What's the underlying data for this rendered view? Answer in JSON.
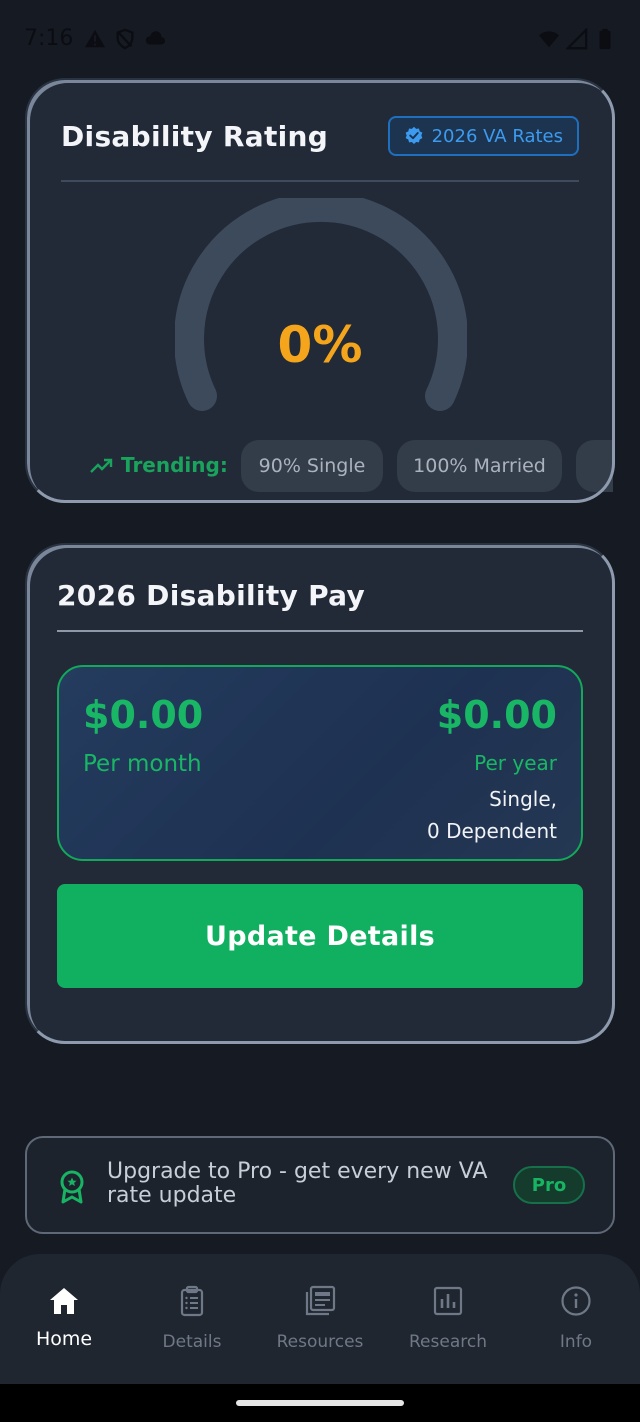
{
  "status_bar": {
    "time": "7:16"
  },
  "rating_card": {
    "title": "Disability Rating",
    "badge": "2026 VA Rates",
    "gauge_value": "0%",
    "gauge_fraction": 0,
    "trending_label": "Trending:",
    "chips": [
      "90% Single",
      "100% Married",
      ""
    ]
  },
  "pay_card": {
    "title": "2026 Disability Pay",
    "monthly_amount": "$0.00",
    "monthly_label": "Per month",
    "yearly_amount": "$0.00",
    "yearly_label": "Per year",
    "status_line1": "Single,",
    "status_line2": "0 Dependent",
    "update_button": "Update Details"
  },
  "pro_banner": {
    "text": "Upgrade to Pro - get every new VA rate update",
    "chip": "Pro"
  },
  "nav": {
    "items": [
      {
        "label": "Home",
        "icon": "home-icon",
        "active": true
      },
      {
        "label": "Details",
        "icon": "clipboard-icon",
        "active": false
      },
      {
        "label": "Resources",
        "icon": "newspaper-icon",
        "active": false
      },
      {
        "label": "Research",
        "icon": "bar-chart-icon",
        "active": false
      },
      {
        "label": "Info",
        "icon": "info-icon",
        "active": false
      }
    ]
  },
  "colors": {
    "accent_green": "#10b060",
    "gauge_orange": "#f5a51c",
    "badge_blue": "#3c9bf0"
  }
}
